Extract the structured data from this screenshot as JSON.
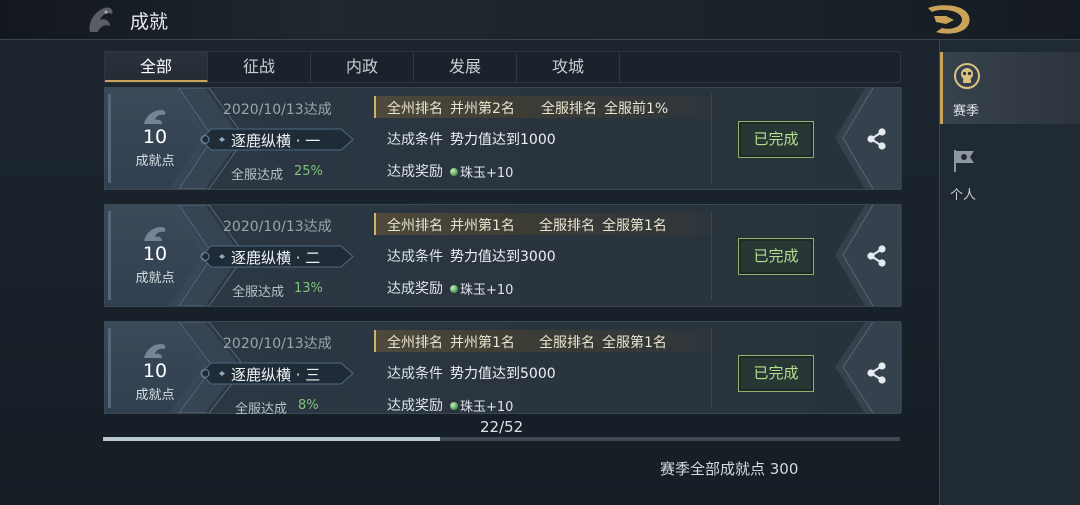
{
  "header": {
    "title": "成就"
  },
  "tabs": [
    {
      "label": "全部",
      "active": true
    },
    {
      "label": "征战",
      "active": false
    },
    {
      "label": "内政",
      "active": false
    },
    {
      "label": "发展",
      "active": false
    },
    {
      "label": "攻城",
      "active": false
    }
  ],
  "achievements": [
    {
      "points": "10",
      "points_label": "成就点",
      "date": "2020/10/13达成",
      "name": "逐鹿纵横 · 一",
      "rate_label": "全服达成",
      "rate": "25%",
      "rank_state_label": "全州排名",
      "rank_state_value": "并州第2名",
      "rank_server_label": "全服排名",
      "rank_server_value": "全服前1%",
      "condition_label": "达成条件",
      "condition_value": "势力值达到1000",
      "reward_label": "达成奖励",
      "reward_value": "珠玉+10",
      "status": "已完成"
    },
    {
      "points": "10",
      "points_label": "成就点",
      "date": "2020/10/13达成",
      "name": "逐鹿纵横 · 二",
      "rate_label": "全服达成",
      "rate": "13%",
      "rank_state_label": "全州排名",
      "rank_state_value": "并州第1名",
      "rank_server_label": "全服排名",
      "rank_server_value": "全服第1名",
      "condition_label": "达成条件",
      "condition_value": "势力值达到3000",
      "reward_label": "达成奖励",
      "reward_value": "珠玉+10",
      "status": "已完成"
    },
    {
      "points": "10",
      "points_label": "成就点",
      "date": "2020/10/13达成",
      "name": "逐鹿纵横 · 三",
      "rate_label": "全服达成",
      "rate": "8%",
      "rank_state_label": "全州排名",
      "rank_state_value": "并州第1名",
      "rank_server_label": "全服排名",
      "rank_server_value": "全服第1名",
      "condition_label": "达成条件",
      "condition_value": "势力值达到5000",
      "reward_label": "达成奖励",
      "reward_value": "珠玉+10",
      "status": "已完成"
    }
  ],
  "pager": {
    "text": "22/52",
    "current": 22,
    "total": 52
  },
  "footer": {
    "season_total": "赛季全部成就点 300"
  },
  "side_nav": [
    {
      "label": "赛季",
      "icon": "season-skull-icon",
      "active": true
    },
    {
      "label": "个人",
      "icon": "personal-flag-icon",
      "active": false
    }
  ],
  "colors": {
    "accent_gold": "#c9a35a",
    "complete_green": "#b4df90",
    "rate_green": "#7fc37a"
  }
}
